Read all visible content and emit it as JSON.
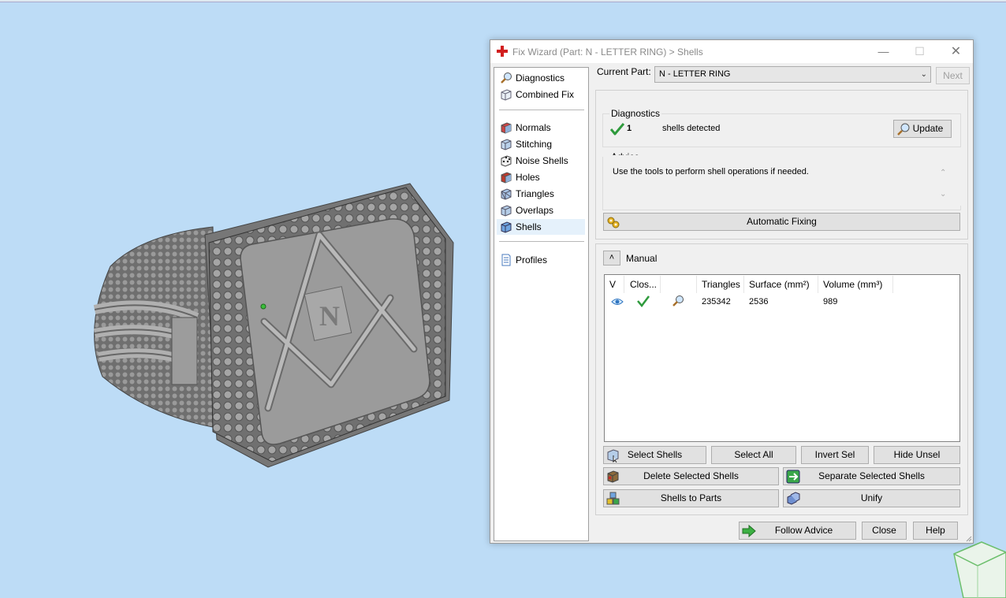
{
  "dialog": {
    "title": "Fix Wizard (Part: N  - LETTER RING) > Shells",
    "win_min": "—",
    "win_max": "☐",
    "win_close": "✕"
  },
  "sidebar": {
    "items": [
      {
        "label": "Diagnostics",
        "icon": "magnifier-icon"
      },
      {
        "label": "Combined Fix",
        "icon": "cube-icon"
      },
      {
        "label": "Normals",
        "icon": "normals-cube-icon"
      },
      {
        "label": "Stitching",
        "icon": "stitching-cube-icon"
      },
      {
        "label": "Noise Shells",
        "icon": "noise-dice-icon"
      },
      {
        "label": "Holes",
        "icon": "holes-cube-icon"
      },
      {
        "label": "Triangles",
        "icon": "triangles-cube-icon"
      },
      {
        "label": "Overlaps",
        "icon": "overlaps-cube-icon"
      },
      {
        "label": "Shells",
        "icon": "shells-cube-icon"
      },
      {
        "label": "Profiles",
        "icon": "document-icon"
      }
    ],
    "active": "Shells"
  },
  "current_part": {
    "label": "Current Part:",
    "value": "N  - LETTER RING",
    "next_label": "Next"
  },
  "diagnostics": {
    "title": "Diagnostics",
    "count": "1",
    "text": "shells detected",
    "update_label": "Update"
  },
  "advice": {
    "title": "Advice",
    "text": "Use the tools to perform shell operations if needed.",
    "auto_fix_label": "Automatic Fixing"
  },
  "manual": {
    "title": "Manual",
    "columns": [
      "V",
      "Clos...",
      "",
      "Triangles",
      "Surface (mm²)",
      "Volume (mm³)"
    ],
    "rows": [
      {
        "triangles": "235342",
        "surface": "2536",
        "volume": "989"
      }
    ],
    "buttons": {
      "select_shells": "Select Shells",
      "select_all": "Select All",
      "invert_sel": "Invert Sel",
      "hide_unsel": "Hide Unsel",
      "delete_selected": "Delete Selected Shells",
      "separate_selected": "Separate Selected Shells",
      "shells_to_parts": "Shells to Parts",
      "unify": "Unify"
    }
  },
  "footer": {
    "follow_advice": "Follow Advice",
    "close": "Close",
    "help": "Help"
  },
  "colors": {
    "viewport_bg": "#bddcf6",
    "check_green": "#2e9a3c",
    "ring_grey": "#8c8c8c"
  }
}
